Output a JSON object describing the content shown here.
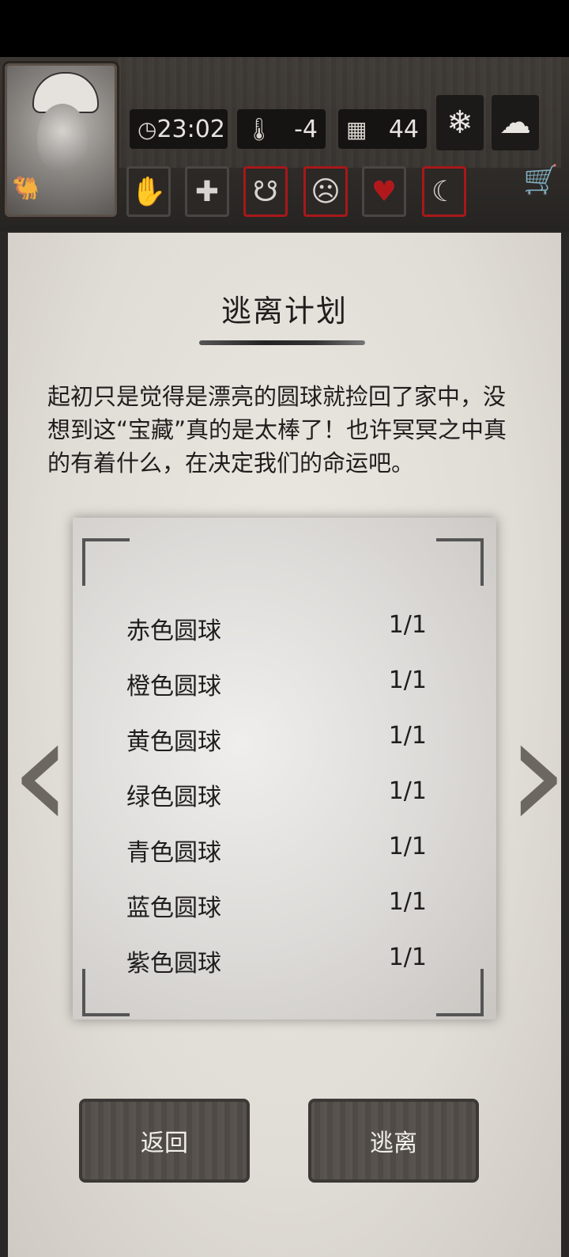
{
  "hud": {
    "time": "23:02",
    "temperature": "-4",
    "days": "44",
    "time_icon": "clock-icon",
    "temp_icon": "thermometer-icon",
    "day_icon": "calendar-icon"
  },
  "weather": [
    "snowflake-icon",
    "snow-cloud-icon"
  ],
  "status_icons": [
    {
      "name": "bandaged-hand-icon",
      "alert": false
    },
    {
      "name": "medical-cross-icon",
      "alert": false
    },
    {
      "name": "stomach-icon",
      "alert": true
    },
    {
      "name": "stressed-head-icon",
      "alert": true
    },
    {
      "name": "heart-icon",
      "alert": false
    },
    {
      "name": "moon-star-icon",
      "alert": true
    }
  ],
  "plan": {
    "title": "逃离计划",
    "intro": "起初只是觉得是漂亮的圆球就捡回了家中，没想到这“宝藏”真的是太棒了！也许冥冥之中真的有着什么，在决定我们的命运吧。",
    "items": [
      {
        "name": "赤色圆球",
        "count": "1/1"
      },
      {
        "name": "橙色圆球",
        "count": "1/1"
      },
      {
        "name": "黄色圆球",
        "count": "1/1"
      },
      {
        "name": "绿色圆球",
        "count": "1/1"
      },
      {
        "name": "青色圆球",
        "count": "1/1"
      },
      {
        "name": "蓝色圆球",
        "count": "1/1"
      },
      {
        "name": "紫色圆球",
        "count": "1/1"
      }
    ]
  },
  "buttons": {
    "back": "返回",
    "escape": "逃离"
  },
  "colors": {
    "alert_border": "#a8171a",
    "paper": "#e4e0da",
    "text": "#1f1e1d"
  }
}
